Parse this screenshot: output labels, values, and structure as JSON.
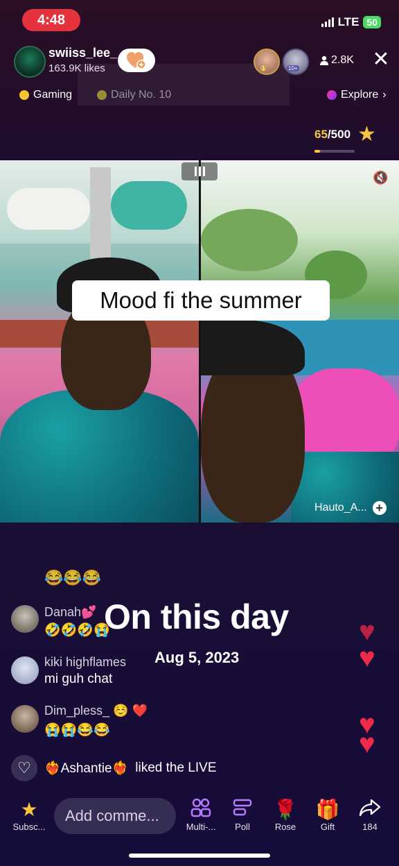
{
  "status_bar": {
    "time": "4:48",
    "network": "LTE",
    "battery": "50"
  },
  "host": {
    "name": "swiiss_lee_",
    "likes": "163.9K likes"
  },
  "viewers": {
    "count": "2.8K",
    "badge_1": "1",
    "badge_2": "10+"
  },
  "tags": {
    "category": "Gaming",
    "daily": "Daily No. 10",
    "explore": "Explore"
  },
  "goal": {
    "current": "65",
    "total": "500",
    "progress": 0.13
  },
  "stream": {
    "caption": "Mood fi the summer",
    "guest": "Hauto_A..."
  },
  "chat": {
    "top_emojis": "😂😂😂",
    "messages": [
      {
        "user": "Danah💕",
        "text": "🤣🤣🤣😭"
      },
      {
        "user": "kiki highflames",
        "text": "mi guh chat"
      },
      {
        "user": "Dim_pless_ ☺️ ❤️",
        "text": "😭😭😂😂"
      }
    ],
    "liked": {
      "user": "❤️‍🔥Ashantie❤️‍🔥",
      "action": "liked the LIVE"
    }
  },
  "memory": {
    "title": "On this day",
    "date": "Aug 5, 2023"
  },
  "bottom_bar": {
    "subscribe": "Subsc...",
    "comment_placeholder": "Add comme...",
    "multi": "Multi-...",
    "poll": "Poll",
    "rose": "Rose",
    "gift": "Gift",
    "share": "184"
  },
  "colors": {
    "accent": "#e5333d",
    "heart": "#ee2b4b",
    "star": "#f6c343"
  }
}
